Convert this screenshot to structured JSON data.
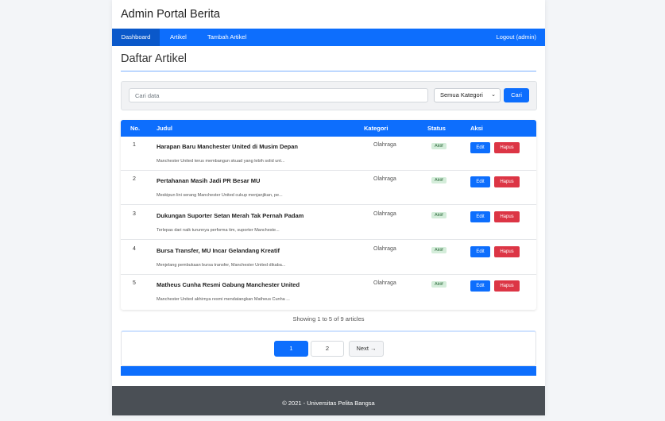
{
  "header": {
    "title": "Admin Portal Berita"
  },
  "nav": {
    "items": [
      {
        "label": "Dashboard",
        "active": true
      },
      {
        "label": "Artikel",
        "active": false
      },
      {
        "label": "Tambah Artikel",
        "active": false
      }
    ],
    "logout": "Logout (admin)"
  },
  "page": {
    "title": "Daftar Artikel"
  },
  "search": {
    "placeholder": "Cari data",
    "category_selected": "Semua Kategori",
    "button": "Cari"
  },
  "table": {
    "headers": [
      "No.",
      "Judul",
      "Kategori",
      "Status",
      "Aksi"
    ],
    "rows": [
      {
        "no": "1",
        "title": "Harapan Baru Manchester United di Musim Depan",
        "excerpt": "Manchester United terus membangun skuad yang lebih solid unt...",
        "category": "Olahraga",
        "status": "Aktif",
        "edit": "Edit",
        "delete": "Hapus"
      },
      {
        "no": "2",
        "title": "Pertahanan Masih Jadi PR Besar MU",
        "excerpt": "Meskipun lini serang Manchester United cukup menjanjikan, pe...",
        "category": "Olahraga",
        "status": "Aktif",
        "edit": "Edit",
        "delete": "Hapus"
      },
      {
        "no": "3",
        "title": "Dukungan Suporter Setan Merah Tak Pernah Padam",
        "excerpt": "Terlepas dari naik turunnya performa tim, suporter Mancheste...",
        "category": "Olahraga",
        "status": "Aktif",
        "edit": "Edit",
        "delete": "Hapus"
      },
      {
        "no": "4",
        "title": "Bursa Transfer, MU Incar Gelandang Kreatif",
        "excerpt": "Menjelang pembukaan bursa transfer, Manchester United dikaba...",
        "category": "Olahraga",
        "status": "Aktif",
        "edit": "Edit",
        "delete": "Hapus"
      },
      {
        "no": "5",
        "title": "Matheus Cunha Resmi Gabung Manchester United",
        "excerpt": "Manchester United akhirnya resmi mendatangkan Matheus Cunha ...",
        "category": "Olahraga",
        "status": "Aktif",
        "edit": "Edit",
        "delete": "Hapus"
      }
    ]
  },
  "summary": "Showing 1 to 5 of 9 articles",
  "pagination": {
    "pages": [
      "1",
      "2"
    ],
    "current": "1",
    "next": "Next →"
  },
  "footer": {
    "text": "© 2021 - Universitas Pelita Bangsa"
  },
  "colors": {
    "primary": "#0d6efd",
    "danger": "#dc3545",
    "footer": "#4a4f55"
  }
}
